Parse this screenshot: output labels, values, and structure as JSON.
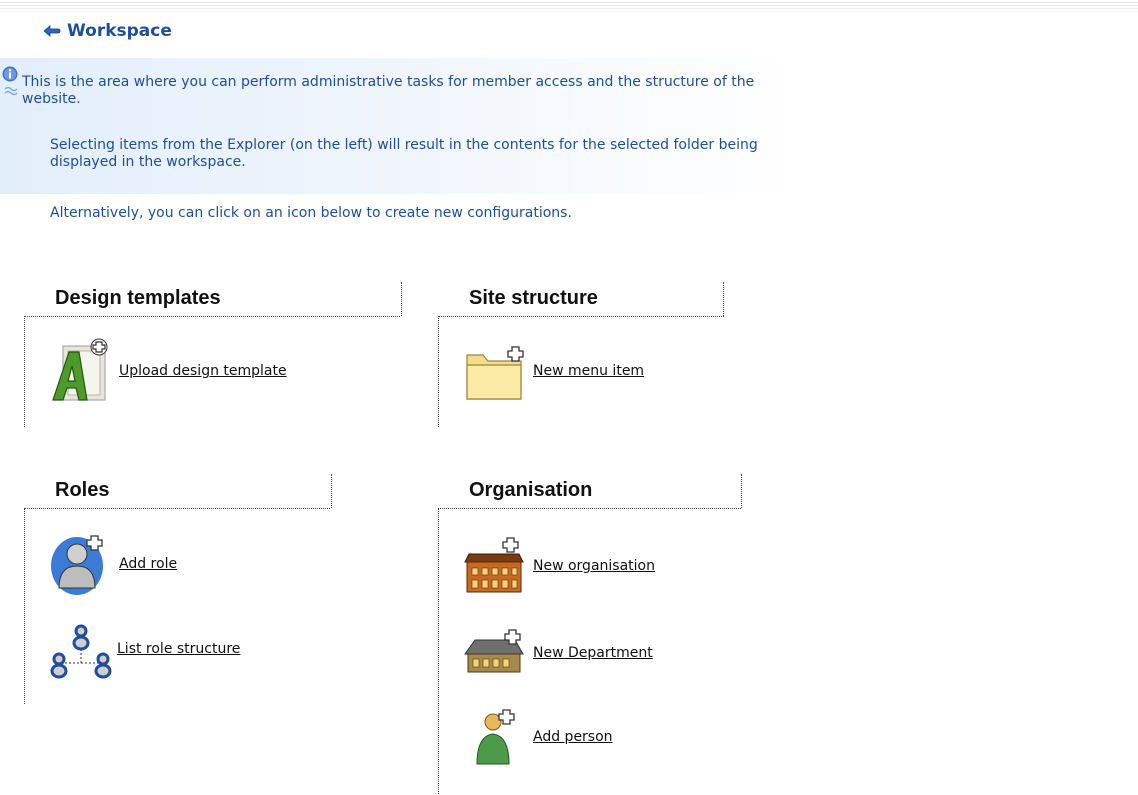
{
  "header": {
    "title": "Workspace"
  },
  "info": {
    "line1": "This is the area where you can perform administrative tasks for member access and the structure of the",
    "line1b": "website.",
    "line2": "Selecting items from the Explorer (on the left) will result in the contents for the selected folder being",
    "line2b": "displayed in the workspace.",
    "line3": "Alternatively, you can click on an icon below to create new configurations."
  },
  "sections": {
    "design": {
      "title": "Design templates",
      "upload_label": "Upload design template"
    },
    "site": {
      "title": "Site structure",
      "menu_label": "New menu item"
    },
    "roles": {
      "title": "Roles",
      "add_label": "Add role",
      "list_label": "List role structure"
    },
    "org": {
      "title": "Organisation",
      "new_org_label": "New organisation",
      "new_dept_label": "New Department",
      "add_person_label": "Add person"
    }
  },
  "colors": {
    "title_blue": "#1f4e9a",
    "text_blue": "#1d4f98",
    "panel_blue": "#e3eefb"
  }
}
